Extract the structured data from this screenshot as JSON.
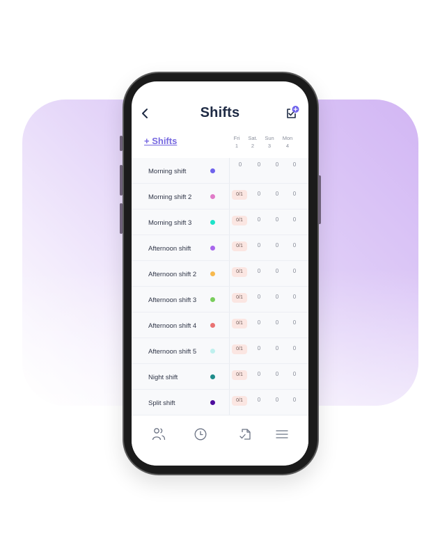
{
  "header": {
    "title": "Shifts",
    "back_icon": "chevron-left-icon",
    "assign_icon": "assign-shift-plus-icon",
    "accent_color": "#7668e0"
  },
  "toolbar": {
    "add_shifts_label": "+ Shifts"
  },
  "days": [
    {
      "name": "Fri",
      "num": "1"
    },
    {
      "name": "Sat.",
      "num": "2"
    },
    {
      "name": "Sun",
      "num": "3"
    },
    {
      "name": "Mon",
      "num": "4"
    }
  ],
  "shifts": [
    {
      "name": "Morning shift",
      "color": "#6f63ec",
      "first": "0",
      "first_badge": false,
      "cells": [
        "0",
        "0",
        "0"
      ]
    },
    {
      "name": "Morning shift 2",
      "color": "#e07bc8",
      "first": "0/1",
      "first_badge": true,
      "cells": [
        "0",
        "0",
        "0"
      ]
    },
    {
      "name": "Morning shift 3",
      "color": "#1de3c9",
      "first": "0/1",
      "first_badge": true,
      "cells": [
        "0",
        "0",
        "0"
      ]
    },
    {
      "name": "Afternoon shift",
      "color": "#a866ec",
      "first": "0/1",
      "first_badge": true,
      "cells": [
        "0",
        "0",
        "0"
      ]
    },
    {
      "name": "Afternoon shift 2",
      "color": "#f7b94e",
      "first": "0/1",
      "first_badge": true,
      "cells": [
        "0",
        "0",
        "0"
      ]
    },
    {
      "name": "Afternoon shift 3",
      "color": "#79cd5c",
      "first": "0/1",
      "first_badge": true,
      "cells": [
        "0",
        "0",
        "0"
      ]
    },
    {
      "name": "Afternoon shift 4",
      "color": "#e97272",
      "first": "0/1",
      "first_badge": true,
      "cells": [
        "0",
        "0",
        "0"
      ]
    },
    {
      "name": "Afternoon shift 5",
      "color": "#bff0ee",
      "first": "0/1",
      "first_badge": true,
      "cells": [
        "0",
        "0",
        "0"
      ]
    },
    {
      "name": "Night shift",
      "color": "#1f8c8a",
      "first": "0/1",
      "first_badge": true,
      "cells": [
        "0",
        "0",
        "0"
      ]
    },
    {
      "name": "Split shift",
      "color": "#4d0c9c",
      "first": "0/1",
      "first_badge": true,
      "cells": [
        "0",
        "0",
        "0"
      ]
    }
  ],
  "bottom_nav": [
    {
      "icon": "team-icon"
    },
    {
      "icon": "clock-icon"
    },
    {
      "icon": "document-check-icon"
    },
    {
      "icon": "menu-icon"
    }
  ]
}
